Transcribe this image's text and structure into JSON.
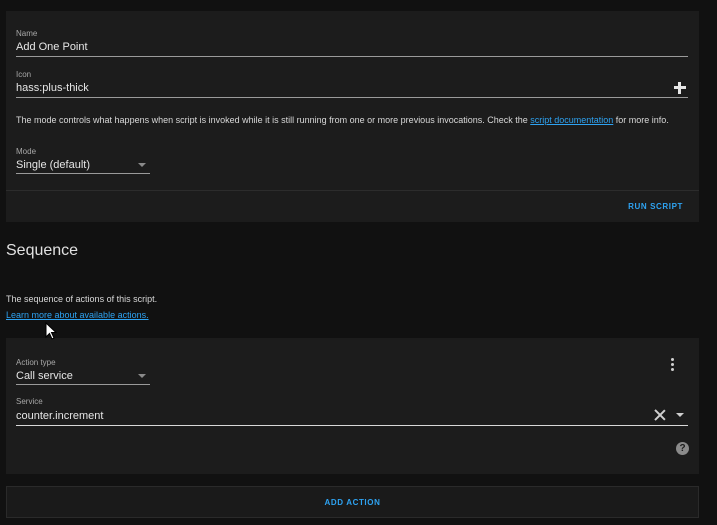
{
  "script_settings": {
    "name_label": "Name",
    "name_value": "Add One Point",
    "icon_label": "Icon",
    "icon_value": "hass:plus-thick",
    "icon_symbol": "plus-thick-icon",
    "mode_description_before": "The mode controls what happens when script is invoked while it is still running from one or more previous invocations. Check the ",
    "mode_description_link": "script documentation",
    "mode_description_after": " for more info.",
    "mode_label": "Mode",
    "mode_value": "Single (default)",
    "run_script_label": "RUN SCRIPT"
  },
  "sequence": {
    "title": "Sequence",
    "description": "The sequence of actions of this script.",
    "learn_more_link": "Learn more about available actions.",
    "actions": [
      {
        "action_type_label": "Action type",
        "action_type_value": "Call service",
        "service_label": "Service",
        "service_value": "counter.increment"
      }
    ],
    "add_action_label": "ADD ACTION"
  },
  "colors": {
    "background": "#111111",
    "card": "#1c1c1c",
    "accent": "#2ea3f2",
    "text": "#e1e1e1"
  }
}
